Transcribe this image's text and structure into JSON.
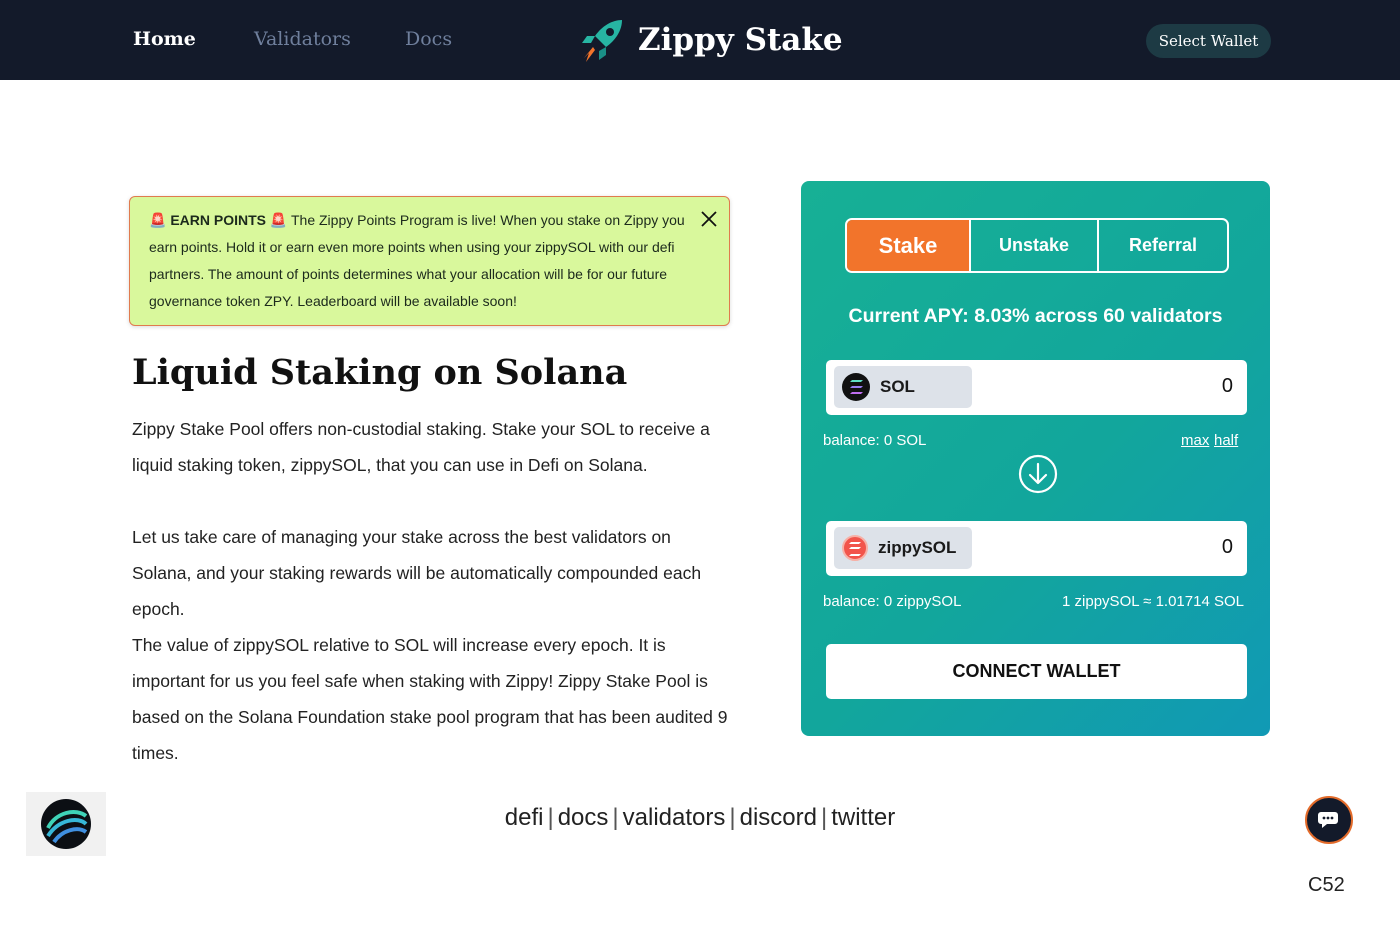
{
  "nav": {
    "links": [
      "Home",
      "Validators",
      "Docs"
    ],
    "brand": "Zippy Stake",
    "wallet_button": "Select Wallet"
  },
  "alert": {
    "badge": "EARN POINTS",
    "text": "The Zippy Points Program is live! When you stake on Zippy you earn points. Hold it or earn even more points when using your zippySOL with our defi partners. The amount of points determines what your allocation will be for our future governance token ZPY. Leaderboard will be available soon!"
  },
  "hero": {
    "title": "Liquid Staking on Solana",
    "paragraphs": [
      "Zippy Stake Pool offers non-custodial staking. Stake your SOL to receive a liquid staking token, zippySOL, that you can use in Defi on Solana.",
      "Let us take care of managing your stake across the best validators on Solana, and your staking rewards will be automatically compounded each epoch.",
      "The value of zippySOL relative to SOL will increase every epoch. It is important for us you feel safe when staking with Zippy! Zippy Stake Pool is based on the Solana Foundation stake pool program that has been audited 9 times."
    ]
  },
  "stake_card": {
    "tabs": [
      "Stake",
      "Unstake",
      "Referral"
    ],
    "active_tab": "Stake",
    "apy": "Current APY: 8.03% across 60 validators",
    "from": {
      "token": "SOL",
      "amount": "0",
      "balance": "balance: 0 SOL",
      "max": "max",
      "half": "half"
    },
    "to": {
      "token": "zippySOL",
      "amount": "0",
      "balance": "balance: 0 zippySOL",
      "rate": "1 zippySOL ≈ 1.01714 SOL"
    },
    "connect_button": "CONNECT WALLET",
    "accent_color": "#f2742b"
  },
  "footer": {
    "links": [
      "defi",
      "docs",
      "validators",
      "discord",
      "twitter"
    ]
  },
  "corner_code": "C52"
}
